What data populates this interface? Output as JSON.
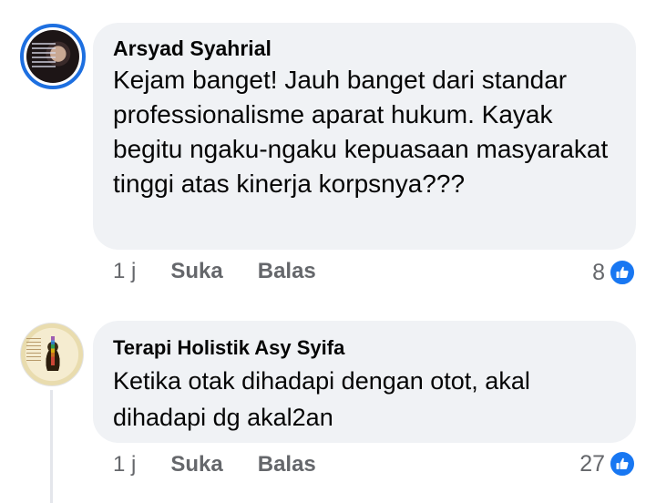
{
  "comments": [
    {
      "author": "Arsyad Syahrial",
      "text": "Kejam banget! Jauh banget dari standar professionalisme aparat hukum. Kayak begitu ngaku-ngaku kepuasaan masyarakat tinggi atas kinerja korpsnya???",
      "time": "1 j",
      "like_label": "Suka",
      "reply_label": "Balas",
      "reaction_count": "8"
    },
    {
      "author": "Terapi Holistik Asy Syifa",
      "text": "Ketika otak dihadapi dengan otot, akal dihadapi dg akal2an",
      "time": "1 j",
      "like_label": "Suka",
      "reply_label": "Balas",
      "reaction_count": "27"
    }
  ],
  "colors": {
    "bubble": "#f0f2f5",
    "secondary_text": "#65676b",
    "like_blue": "#1877f2"
  },
  "icons": {
    "reaction": "like-thumb-icon"
  }
}
